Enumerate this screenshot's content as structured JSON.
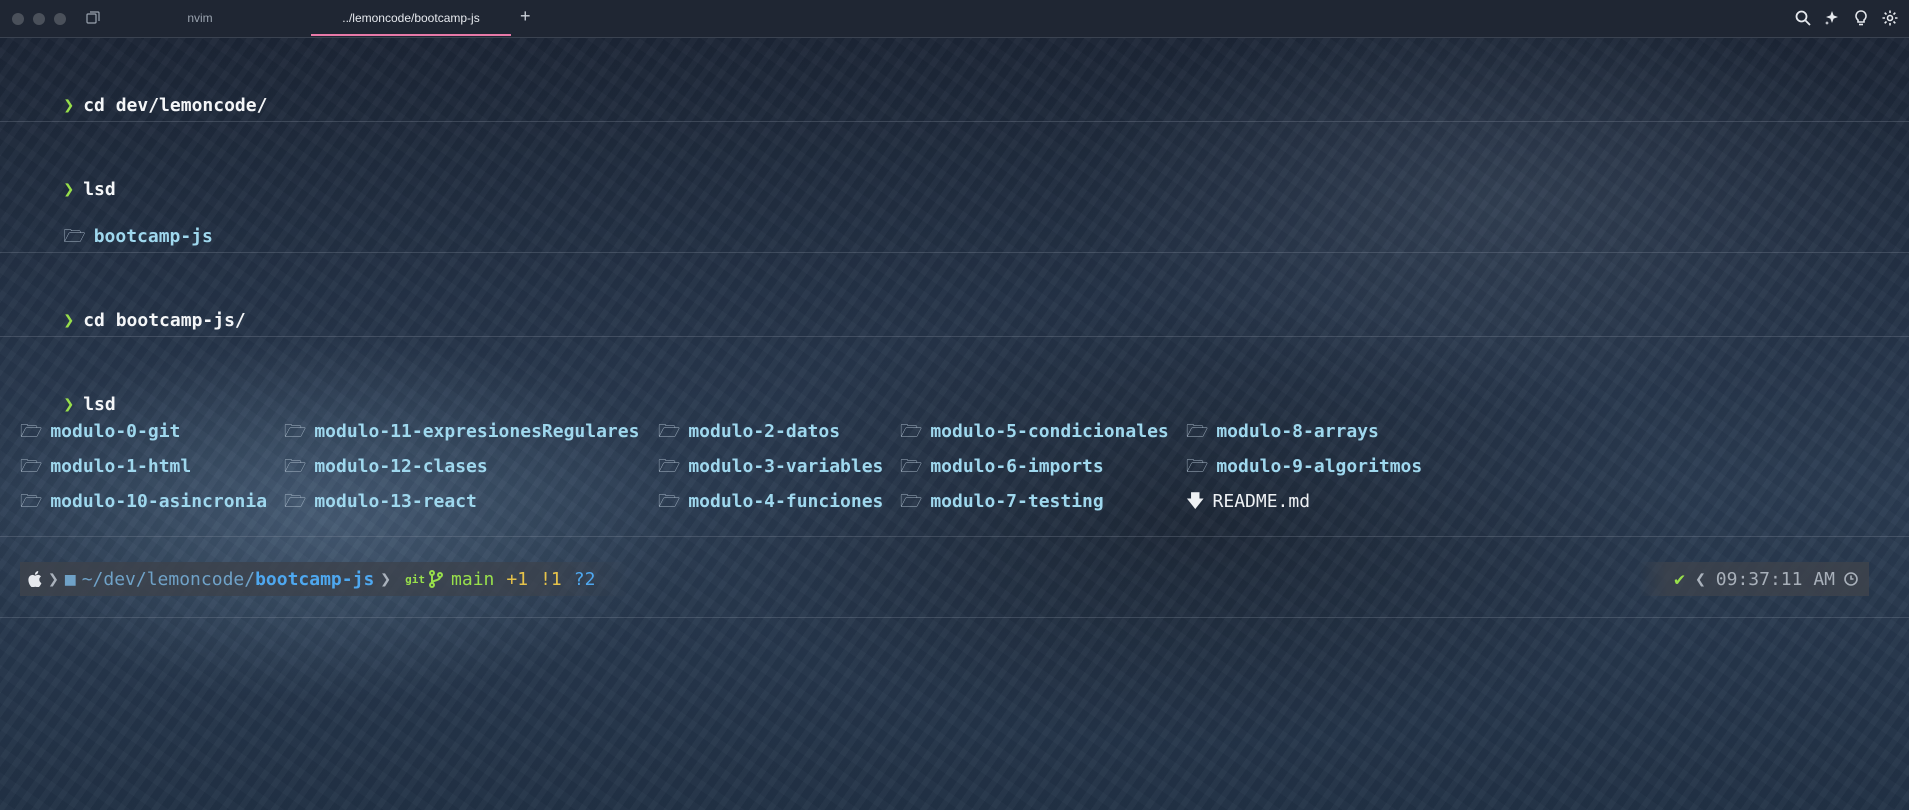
{
  "window": {
    "tabs": [
      {
        "label": "nvim",
        "active": false
      },
      {
        "label": "../lemoncode/bootcamp-js",
        "active": true
      }
    ],
    "new_tab_label": "+",
    "toolbar_icons": [
      "search-icon",
      "sparkle-icon",
      "lightbulb-icon",
      "gear-icon"
    ]
  },
  "blocks": [
    {
      "prompt": "❯",
      "command": "cd dev/lemoncode/"
    },
    {
      "prompt": "❯",
      "command": "lsd",
      "output": [
        "bootcamp-js"
      ]
    },
    {
      "prompt": "❯",
      "command": "cd bootcamp-js/"
    },
    {
      "prompt": "❯",
      "command": "lsd"
    }
  ],
  "listing": {
    "columns": [
      [
        "modulo-0-git",
        "modulo-1-html",
        "modulo-10-asincronia"
      ],
      [
        "modulo-11-expresionesRegulares",
        "modulo-12-clases",
        "modulo-13-react"
      ],
      [
        "modulo-2-datos",
        "modulo-3-variables",
        "modulo-4-funciones"
      ],
      [
        "modulo-5-condicionales",
        "modulo-6-imports",
        "modulo-7-testing"
      ],
      [
        "modulo-8-arrays",
        "modulo-9-algoritmos",
        "README.md"
      ]
    ]
  },
  "prompt_bar": {
    "path_prefix": "~/dev/lemoncode/",
    "path_current": "bootcamp-js",
    "git_label": "git",
    "branch": "main",
    "ahead": "+1",
    "modified": "!1",
    "untracked": "?2",
    "status_check": "✔",
    "time": "09:37:11 AM"
  },
  "colors": {
    "prompt": "#98e04b",
    "folder": "#9fd8ee",
    "accent_tab": "#e879a8"
  }
}
